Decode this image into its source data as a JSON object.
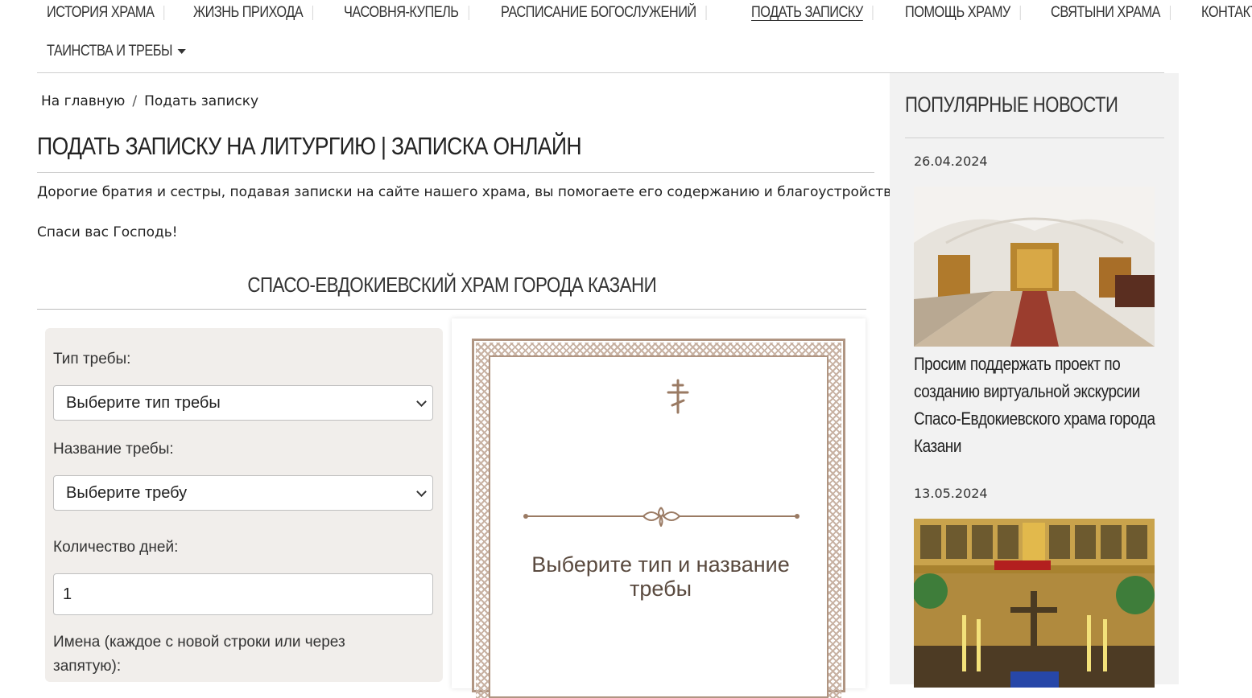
{
  "nav": {
    "items": [
      "ИСТОРИЯ ХРАМА",
      "ЖИЗНЬ ПРИХОДА",
      "ЧАСОВНЯ-КУПЕЛЬ",
      "РАСПИСАНИЕ БОГОСЛУЖЕНИЙ",
      "ПОДАТЬ ЗАПИСКУ",
      "ПОМОЩЬ ХРАМУ",
      "СВЯТЫНИ ХРАМА",
      "КОНТАКТЫ"
    ],
    "active": "ПОДАТЬ ЗАПИСКУ",
    "dropdown": "ТАИНСТВА И ТРЕБЫ"
  },
  "breadcrumb": {
    "home": "На главную",
    "separator": "/",
    "current": "Подать записку"
  },
  "page": {
    "title": "ПОДАТЬ ЗАПИСКУ НА ЛИТУРГИЮ | ЗАПИСКА ОНЛАЙН",
    "intro": "Дорогие братия и сестры, подавая записки на сайте нашего храма, вы помогаете его содержанию и благоустройству.",
    "thanks": "Спаси вас Господь!",
    "section_title": "СПАСО-ЕВДОКИЕВСКИЙ ХРАМ ГОРОДА КАЗАНИ"
  },
  "form": {
    "type_label": "Тип требы:",
    "type_value": "Выберите тип требы",
    "name_label": "Название требы:",
    "name_value": "Выберите требу",
    "days_label": "Количество дней:",
    "days_value": "1",
    "names_label_1": "Имена (каждое с новой строки или через",
    "names_label_2": "запятую):"
  },
  "preview": {
    "text": "Выберите тип и название требы"
  },
  "sidebar": {
    "title": "ПОПУЛЯРНЫЕ НОВОСТИ",
    "news": [
      {
        "date": "26.04.2024",
        "title": "Просим поддержать проект по созданию виртуальной экскурсии Спасо-Евдокиевского храма города Казани"
      },
      {
        "date": "13.05.2024",
        "title": ""
      }
    ]
  },
  "colors": {
    "frame": "#b09582",
    "panel": "#f1eeeb",
    "sidebar": "#f2f2f2",
    "preview_text": "#5a4a3f"
  }
}
